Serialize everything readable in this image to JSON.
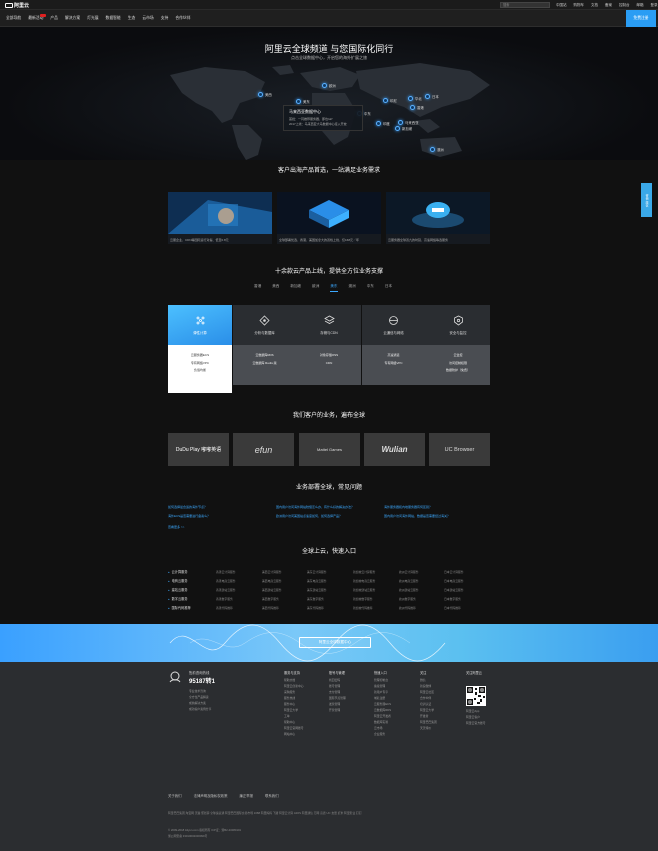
{
  "topbar": {
    "logo_text": "阿里云",
    "search_placeholder": "搜索",
    "links": [
      "中国站",
      "购物车",
      "文档",
      "备案",
      "控制台",
      "邮箱",
      "登录"
    ]
  },
  "nav": {
    "items": [
      "全部导航",
      "最新活动",
      "产品",
      "解决方案",
      "灯光展",
      "数据智能",
      "生态",
      "云市场",
      "支持",
      "合作伙伴"
    ],
    "cta": "免费注册"
  },
  "hero": {
    "title": "阿里云全球频道 与您国际化同行",
    "subtitle": "点击全球数据中心，开启您的海外扩展之旅",
    "pins": [
      "美西",
      "美东",
      "欧洲",
      "印度",
      "中东",
      "华北",
      "日本",
      "香港",
      "新加坡",
      "马来西亚",
      "印尼",
      "澳洲"
    ],
    "card": {
      "title": "马来西亚数据中心",
      "line1": "首批：一同推荐服务器，即也IoP",
      "line2": "2017上线：马来西亚大马数据中心接入开放"
    }
  },
  "promo": {
    "title": "客户出海产品首选，一站满足业务需求",
    "cards": [
      {
        "caption": "云服企业、CDN等国际运行对提、低至0.8元"
      },
      {
        "caption": "全球部署优选、香港、美国加拿大的双栈上线、仅168元／年"
      },
      {
        "caption": "云服务器全球双九的时延、高速网络等选服务"
      }
    ]
  },
  "products": {
    "title": "十余款云产品上线，提供全方位业务支撑",
    "tabs": [
      "香港",
      "美西",
      "新加坡",
      "欧洲",
      "美东",
      "澳洲",
      "中东",
      "日本"
    ],
    "active_tab": "美东",
    "cols": [
      {
        "label": "弹性计算",
        "items": [
          "云服务器ECS",
          "专有网络VPC",
          "负载均衡"
        ]
      },
      {
        "label": "分析与数据库",
        "items": [
          "云数据库RDS",
          "云数据库 Redis 版"
        ]
      },
      {
        "label": "存储与CDN",
        "items": [
          "对象存储OSS",
          "CDN"
        ]
      },
      {
        "label": "云通信与网络",
        "items": [
          "高速通道",
          "专有网络VPC"
        ]
      },
      {
        "label": "安全与监控",
        "items": [
          "云监控",
          "访问控制权限",
          "数据防护（免费）"
        ]
      }
    ]
  },
  "customers": {
    "title": "我们客户的业务，遍布全球",
    "logos": [
      "DuDu Play 嘟嘟英语",
      "efun",
      "Mattel Games",
      "Wulian",
      "UC Browser"
    ]
  },
  "faq": {
    "title": "业务部署全球，常见问题",
    "items": [
      "如何选择最合适的海外节点？",
      "海外ECS是否需要进行备案么？",
      "国内用户访问海外网站较慢怎么办，有什么好的解决办法？",
      "欧洲用户访问美国站点速度如何，如何选择产品？",
      "海外服务器和内地服务器有何区别？",
      "国内用户访问海外网站，数据是否需要经过海关？"
    ],
    "more": "查看更多 >>"
  },
  "entry": {
    "title": "全球上云，快速入口",
    "categories": [
      "云计算服务",
      "电商云服务",
      "建站云服务",
      "数字云服务",
      "国际代码推荐"
    ],
    "cols": [
      [
        "香港云计算服务",
        "香港电商云服务",
        "香港建站云服务",
        "香港数字服务",
        "香港代码推荐"
      ],
      [
        "美西云计算服务",
        "美西电商云服务",
        "美西建站云服务",
        "美西数字服务",
        "美西代码推荐"
      ],
      [
        "美东云计算服务",
        "美东电商云服务",
        "美东建站云服务",
        "美东数字服务",
        "美东代码推荐"
      ],
      [
        "新加坡云计算服务",
        "新加坡电商云服务",
        "新加坡建站云服务",
        "新加坡数字服务",
        "新加坡代码推荐"
      ],
      [
        "欧洲云计算服务",
        "欧洲电商云服务",
        "欧洲建站云服务",
        "欧洲数字服务",
        "欧洲代码推荐"
      ],
      [
        "日本云计算服务",
        "日本电商云服务",
        "日本建站云服务",
        "日本数字服务",
        "日本代码推荐"
      ]
    ]
  },
  "band": {
    "button": "阿里云全球数据中心"
  },
  "footer": {
    "hotline_label": "售前咨询热线",
    "hotline_number": "95187转1",
    "hotline_links": [
      "专业技术咨询",
      "全方位产品解读",
      "成熟解决方案",
      "成功客户案例分享"
    ],
    "cols": [
      {
        "head": "服务与支持",
        "items": [
          "帮助文档",
          "阿里云创新中心",
          "采购服务",
          "服务热线",
          "服务中心",
          "阿里云大学",
          "工单",
          "帮助中心",
          "阿里云官网账号",
          "网站中心"
        ]
      },
      {
        "head": "账号与管理",
        "items": [
          "找回密码",
          "账号管理",
          "支付管理",
          "国际节点管理",
          "发票管理",
          "开票管理"
        ]
      },
      {
        "head": "快速入口",
        "items": [
          "管理控制台",
          "备案管理",
          "新用户专享",
          "域名注册",
          "云服务器ECS",
          "云数据库RDS",
          "阿里云开发者",
          "数据库实验",
          "云市场",
          "企业服务"
        ]
      },
      {
        "head": "关注",
        "items": [
          "微信",
          "新浪微博",
          "阿里云社区",
          "合作伙伴",
          "培训认证",
          "阿里云大学",
          "开发者",
          "阿里巴巴集团",
          "天天特价"
        ]
      }
    ],
    "qr_title": "关注阿里云",
    "qr_links": [
      "阿里云App",
      "阿里云客户",
      "阿里云官方账号"
    ],
    "bottom_links": [
      "关于我们",
      "法律声明及隐私权政策",
      "廉正举报",
      "联系我们"
    ],
    "group_links": "阿里巴巴集团   淘宝网   天猫   聚划算   全球速卖通   阿里巴巴国际交易市场   1688   阿里妈妈   飞猪   阿里云计算   AliOS   阿里通信   万网   高德   UC   友盟   虾米   阿里影业   钉钉",
    "copyright": "© 2009-2018 Aliyun.com 版权所有 ICP证：浙B2-20080101",
    "police": "浙公网安备 33010002000099号"
  },
  "side_float": "咨询·建议"
}
